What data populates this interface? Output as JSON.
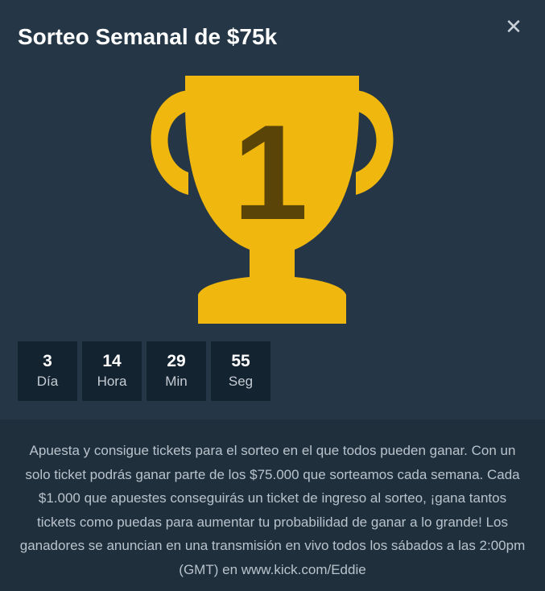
{
  "modal": {
    "title": "Sorteo Semanal de $75k",
    "close_label": "✕",
    "trophy": {
      "number": "1",
      "colors": {
        "cup": "#f0b70e",
        "number": "#5a4408"
      }
    },
    "countdown": [
      {
        "value": "3",
        "unit": "Día"
      },
      {
        "value": "14",
        "unit": "Hora"
      },
      {
        "value": "29",
        "unit": "Min"
      },
      {
        "value": "55",
        "unit": "Seg"
      }
    ],
    "description": "Apuesta y consigue tickets para el sorteo en el que todos pueden ganar. Con un solo ticket podrás ganar parte de los $75.000 que sorteamos cada semana. Cada $1.000 que apuestes conseguirás un ticket de ingreso al sorteo, ¡gana tantos tickets como puedas para aumentar tu probabilidad de ganar a lo grande! Los ganadores se anuncian en una transmisión en vivo todos los sábados a las 2:00pm (GMT) en www.kick.com/Eddie"
  }
}
